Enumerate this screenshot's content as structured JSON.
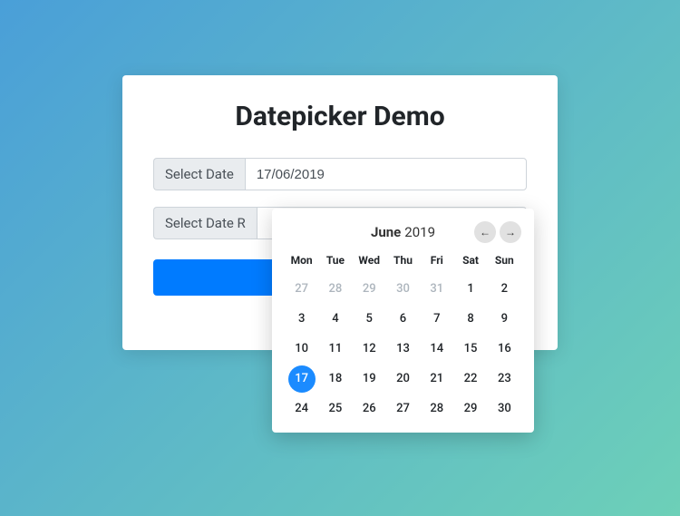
{
  "title": "Datepicker Demo",
  "inputs": {
    "date": {
      "label": "Select Date",
      "value": "17/06/2019"
    },
    "range": {
      "label": "Select Date R",
      "value": ""
    }
  },
  "button": {
    "label": ""
  },
  "calendar": {
    "month": "June",
    "year": "2019",
    "nav": {
      "prev": "←",
      "next": "→"
    },
    "weekdays": [
      "Mon",
      "Tue",
      "Wed",
      "Thu",
      "Fri",
      "Sat",
      "Sun"
    ],
    "selected": 17,
    "days": [
      {
        "n": 27,
        "muted": true
      },
      {
        "n": 28,
        "muted": true
      },
      {
        "n": 29,
        "muted": true
      },
      {
        "n": 30,
        "muted": true
      },
      {
        "n": 31,
        "muted": true
      },
      {
        "n": 1
      },
      {
        "n": 2
      },
      {
        "n": 3
      },
      {
        "n": 4
      },
      {
        "n": 5
      },
      {
        "n": 6
      },
      {
        "n": 7
      },
      {
        "n": 8
      },
      {
        "n": 9
      },
      {
        "n": 10
      },
      {
        "n": 11
      },
      {
        "n": 12
      },
      {
        "n": 13
      },
      {
        "n": 14
      },
      {
        "n": 15
      },
      {
        "n": 16
      },
      {
        "n": 17,
        "selected": true
      },
      {
        "n": 18
      },
      {
        "n": 19
      },
      {
        "n": 20
      },
      {
        "n": 21
      },
      {
        "n": 22
      },
      {
        "n": 23
      },
      {
        "n": 24
      },
      {
        "n": 25
      },
      {
        "n": 26
      },
      {
        "n": 27
      },
      {
        "n": 28
      },
      {
        "n": 29
      },
      {
        "n": 30
      }
    ]
  }
}
